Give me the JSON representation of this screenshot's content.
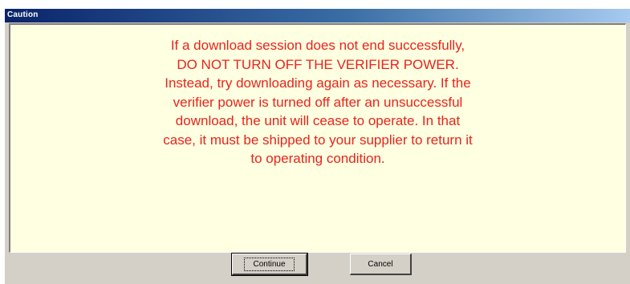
{
  "window": {
    "title": "Caution"
  },
  "message": {
    "text": "If a download session does not end successfully,\nDO NOT TURN OFF THE VERIFIER POWER.\nInstead, try downloading again as necessary.  If the\nverifier power is turned off after an unsuccessful\ndownload, the unit will cease to operate. In that\ncase, it must be shipped to your supplier to return it\nto operating condition.",
    "color": "#e8241d",
    "background": "#ffffe1"
  },
  "buttons": {
    "continue_label": "Continue",
    "cancel_label": "Cancel"
  }
}
